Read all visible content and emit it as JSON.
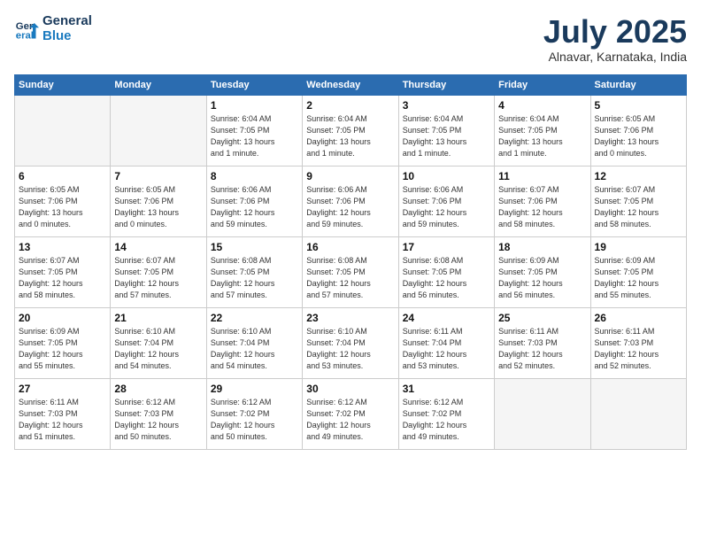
{
  "logo": {
    "line1": "General",
    "line2": "Blue"
  },
  "title": "July 2025",
  "location": "Alnavar, Karnataka, India",
  "days_of_week": [
    "Sunday",
    "Monday",
    "Tuesday",
    "Wednesday",
    "Thursday",
    "Friday",
    "Saturday"
  ],
  "weeks": [
    [
      {
        "day": "",
        "info": ""
      },
      {
        "day": "",
        "info": ""
      },
      {
        "day": "1",
        "info": "Sunrise: 6:04 AM\nSunset: 7:05 PM\nDaylight: 13 hours\nand 1 minute."
      },
      {
        "day": "2",
        "info": "Sunrise: 6:04 AM\nSunset: 7:05 PM\nDaylight: 13 hours\nand 1 minute."
      },
      {
        "day": "3",
        "info": "Sunrise: 6:04 AM\nSunset: 7:05 PM\nDaylight: 13 hours\nand 1 minute."
      },
      {
        "day": "4",
        "info": "Sunrise: 6:04 AM\nSunset: 7:05 PM\nDaylight: 13 hours\nand 1 minute."
      },
      {
        "day": "5",
        "info": "Sunrise: 6:05 AM\nSunset: 7:06 PM\nDaylight: 13 hours\nand 0 minutes."
      }
    ],
    [
      {
        "day": "6",
        "info": "Sunrise: 6:05 AM\nSunset: 7:06 PM\nDaylight: 13 hours\nand 0 minutes."
      },
      {
        "day": "7",
        "info": "Sunrise: 6:05 AM\nSunset: 7:06 PM\nDaylight: 13 hours\nand 0 minutes."
      },
      {
        "day": "8",
        "info": "Sunrise: 6:06 AM\nSunset: 7:06 PM\nDaylight: 12 hours\nand 59 minutes."
      },
      {
        "day": "9",
        "info": "Sunrise: 6:06 AM\nSunset: 7:06 PM\nDaylight: 12 hours\nand 59 minutes."
      },
      {
        "day": "10",
        "info": "Sunrise: 6:06 AM\nSunset: 7:06 PM\nDaylight: 12 hours\nand 59 minutes."
      },
      {
        "day": "11",
        "info": "Sunrise: 6:07 AM\nSunset: 7:06 PM\nDaylight: 12 hours\nand 58 minutes."
      },
      {
        "day": "12",
        "info": "Sunrise: 6:07 AM\nSunset: 7:05 PM\nDaylight: 12 hours\nand 58 minutes."
      }
    ],
    [
      {
        "day": "13",
        "info": "Sunrise: 6:07 AM\nSunset: 7:05 PM\nDaylight: 12 hours\nand 58 minutes."
      },
      {
        "day": "14",
        "info": "Sunrise: 6:07 AM\nSunset: 7:05 PM\nDaylight: 12 hours\nand 57 minutes."
      },
      {
        "day": "15",
        "info": "Sunrise: 6:08 AM\nSunset: 7:05 PM\nDaylight: 12 hours\nand 57 minutes."
      },
      {
        "day": "16",
        "info": "Sunrise: 6:08 AM\nSunset: 7:05 PM\nDaylight: 12 hours\nand 57 minutes."
      },
      {
        "day": "17",
        "info": "Sunrise: 6:08 AM\nSunset: 7:05 PM\nDaylight: 12 hours\nand 56 minutes."
      },
      {
        "day": "18",
        "info": "Sunrise: 6:09 AM\nSunset: 7:05 PM\nDaylight: 12 hours\nand 56 minutes."
      },
      {
        "day": "19",
        "info": "Sunrise: 6:09 AM\nSunset: 7:05 PM\nDaylight: 12 hours\nand 55 minutes."
      }
    ],
    [
      {
        "day": "20",
        "info": "Sunrise: 6:09 AM\nSunset: 7:05 PM\nDaylight: 12 hours\nand 55 minutes."
      },
      {
        "day": "21",
        "info": "Sunrise: 6:10 AM\nSunset: 7:04 PM\nDaylight: 12 hours\nand 54 minutes."
      },
      {
        "day": "22",
        "info": "Sunrise: 6:10 AM\nSunset: 7:04 PM\nDaylight: 12 hours\nand 54 minutes."
      },
      {
        "day": "23",
        "info": "Sunrise: 6:10 AM\nSunset: 7:04 PM\nDaylight: 12 hours\nand 53 minutes."
      },
      {
        "day": "24",
        "info": "Sunrise: 6:11 AM\nSunset: 7:04 PM\nDaylight: 12 hours\nand 53 minutes."
      },
      {
        "day": "25",
        "info": "Sunrise: 6:11 AM\nSunset: 7:03 PM\nDaylight: 12 hours\nand 52 minutes."
      },
      {
        "day": "26",
        "info": "Sunrise: 6:11 AM\nSunset: 7:03 PM\nDaylight: 12 hours\nand 52 minutes."
      }
    ],
    [
      {
        "day": "27",
        "info": "Sunrise: 6:11 AM\nSunset: 7:03 PM\nDaylight: 12 hours\nand 51 minutes."
      },
      {
        "day": "28",
        "info": "Sunrise: 6:12 AM\nSunset: 7:03 PM\nDaylight: 12 hours\nand 50 minutes."
      },
      {
        "day": "29",
        "info": "Sunrise: 6:12 AM\nSunset: 7:02 PM\nDaylight: 12 hours\nand 50 minutes."
      },
      {
        "day": "30",
        "info": "Sunrise: 6:12 AM\nSunset: 7:02 PM\nDaylight: 12 hours\nand 49 minutes."
      },
      {
        "day": "31",
        "info": "Sunrise: 6:12 AM\nSunset: 7:02 PM\nDaylight: 12 hours\nand 49 minutes."
      },
      {
        "day": "",
        "info": ""
      },
      {
        "day": "",
        "info": ""
      }
    ]
  ]
}
